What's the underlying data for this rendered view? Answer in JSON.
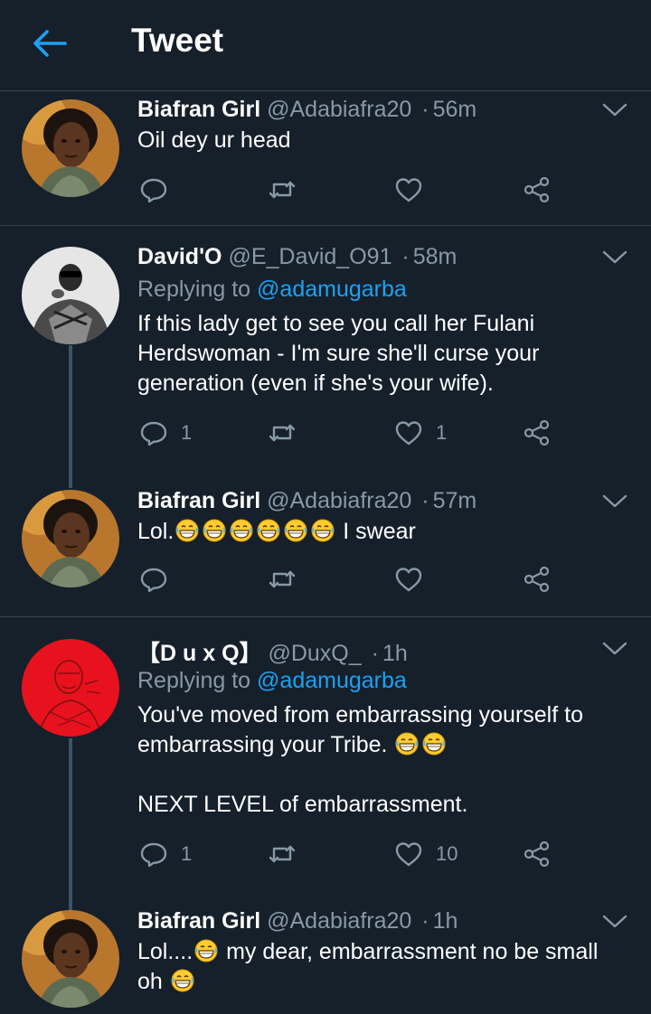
{
  "header": {
    "title": "Tweet",
    "back_icon": "arrow-left-icon",
    "accent": "#1da1f2"
  },
  "colors": {
    "background": "#15202b",
    "muted": "#8899a6",
    "link": "#1da1f2",
    "divider": "#38444d"
  },
  "tweets": [
    {
      "name": "Biafran Girl",
      "handle": "@Adabiafra20",
      "time": "56m",
      "lines": [
        "Oil dey ur head"
      ],
      "replies": "",
      "retweets": "",
      "likes": ""
    },
    {
      "name": "David'O",
      "handle": "@E_David_O91",
      "time": "58m",
      "replying_label": "Replying to",
      "replying_to": "@adamugarba",
      "lines": [
        "If this lady get to see you call her Fulani",
        "Herdswoman - I'm sure she'll curse your",
        "generation (even if she's your wife)."
      ],
      "replies": "1",
      "retweets": "",
      "likes": "1"
    },
    {
      "name": "Biafran Girl",
      "handle": "@Adabiafra20",
      "time": "57m",
      "text_prefix": "Lol.",
      "text_suffix": " I swear",
      "replies": "",
      "retweets": "",
      "likes": ""
    },
    {
      "name": "【D u x Q】",
      "handle": "@DuxQ_",
      "time": "1h",
      "replying_label": "Replying to",
      "replying_to": "@adamugarba",
      "line1": "You've moved from embarrassing yourself to",
      "line2": "embarrassing your Tribe.",
      "line3": "NEXT LEVEL of embarrassment.",
      "replies": "1",
      "retweets": "",
      "likes": "10"
    },
    {
      "name": "Biafran Girl",
      "handle": "@Adabiafra20",
      "time": "1h",
      "text_prefix": "Lol....",
      "text_middle": " my dear, embarrassment no be small",
      "text_line2": "oh"
    }
  ]
}
